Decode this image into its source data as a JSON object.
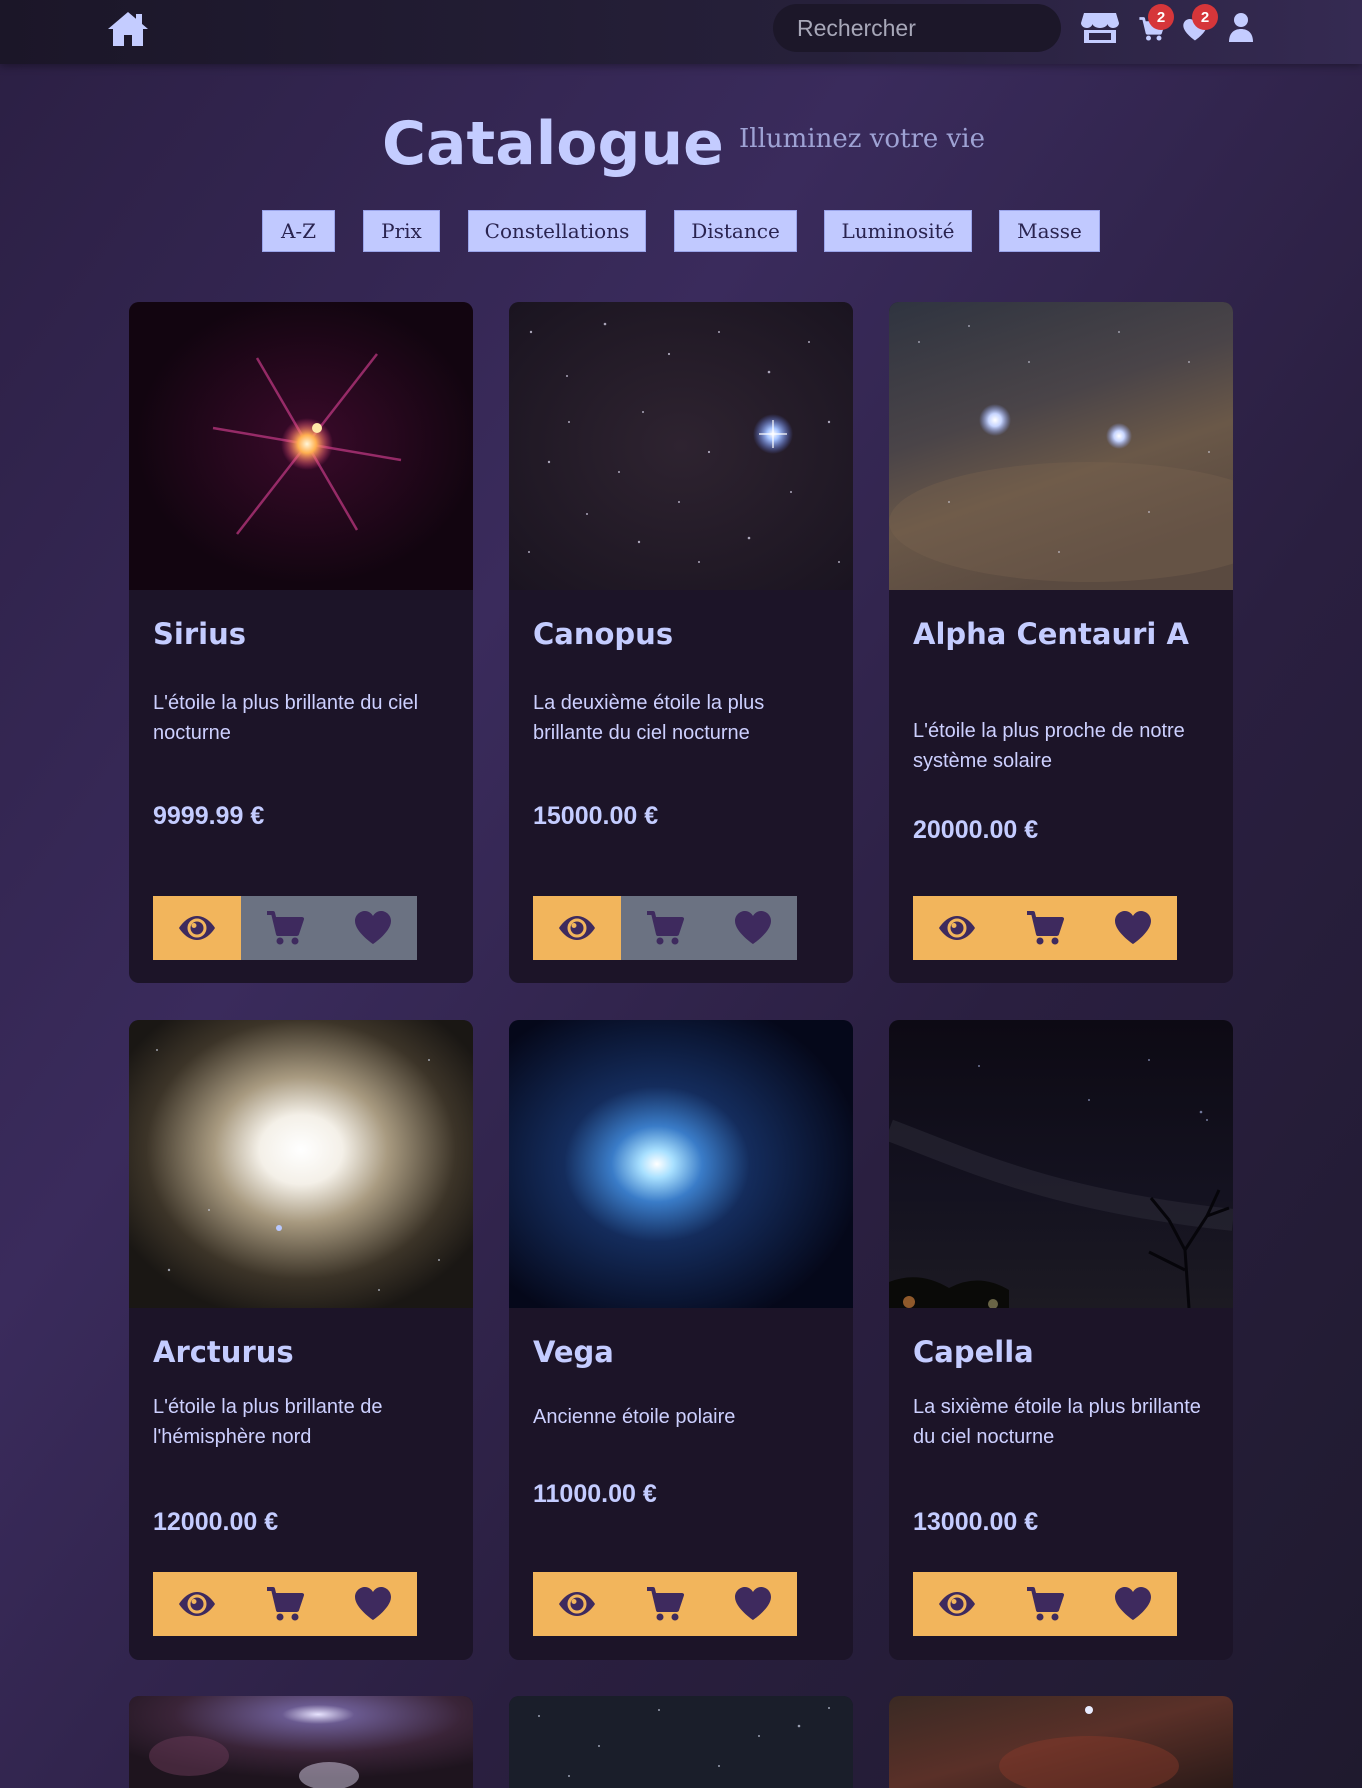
{
  "navbar": {
    "search_placeholder": "Rechercher",
    "cart_count": "2",
    "wishlist_count": "2"
  },
  "header": {
    "title": "Catalogue",
    "subtitle": "Illuminez votre vie"
  },
  "filters": [
    "A-Z",
    "Prix",
    "Constellations",
    "Distance",
    "Luminosité",
    "Masse"
  ],
  "products": [
    {
      "name": "Sirius",
      "description": "L'étoile la plus brillante du ciel nocturne",
      "price": "9999.99 €",
      "actions_state": "view-only"
    },
    {
      "name": "Canopus",
      "description": "La deuxième étoile la plus brillante du ciel nocturne",
      "price": "15000.00 €",
      "actions_state": "view-only"
    },
    {
      "name": "Alpha Centauri A",
      "description": "L'étoile la plus proche de notre système solaire",
      "price": "20000.00 €",
      "actions_state": "all-active"
    },
    {
      "name": "Arcturus",
      "description": "L'étoile la plus brillante de l'hémisphère nord",
      "price": "12000.00 €",
      "actions_state": "all-active"
    },
    {
      "name": "Vega",
      "description": "Ancienne étoile polaire",
      "price": "11000.00 €",
      "actions_state": "all-active"
    },
    {
      "name": "Capella",
      "description": "La sixième étoile la plus brillante du ciel nocturne",
      "price": "13000.00 €",
      "actions_state": "all-active"
    }
  ],
  "colors": {
    "accent": "#f2b55c",
    "inactive": "#6b7282",
    "text": "#c4ccff",
    "card_bg": "#1c1428",
    "badge": "#d6363a"
  },
  "icons": [
    "home-icon",
    "store-icon",
    "cart-icon",
    "heart-icon",
    "user-icon",
    "eye-icon"
  ]
}
